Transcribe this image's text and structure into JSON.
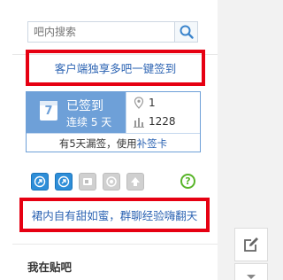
{
  "search": {
    "placeholder": "吧内搜索"
  },
  "top_link": "客户端独享多吧一键签到",
  "sign_card": {
    "signed_label": "已签到",
    "calendar_day": "7",
    "streak_label": "连续 5 天",
    "rank": "1",
    "count": "1228",
    "hint_prefix": "有5天漏签，使用",
    "hint_link": "补签卡"
  },
  "bottom_link": "裙内自有甜如蜜，群聊经验嗨翻天",
  "section_title": "我在贴吧",
  "help_mark": "?",
  "colors": {
    "accent": "#6ea0d8",
    "link": "#2d64b3",
    "highlight": "#e60012",
    "help": "#59b52a"
  }
}
